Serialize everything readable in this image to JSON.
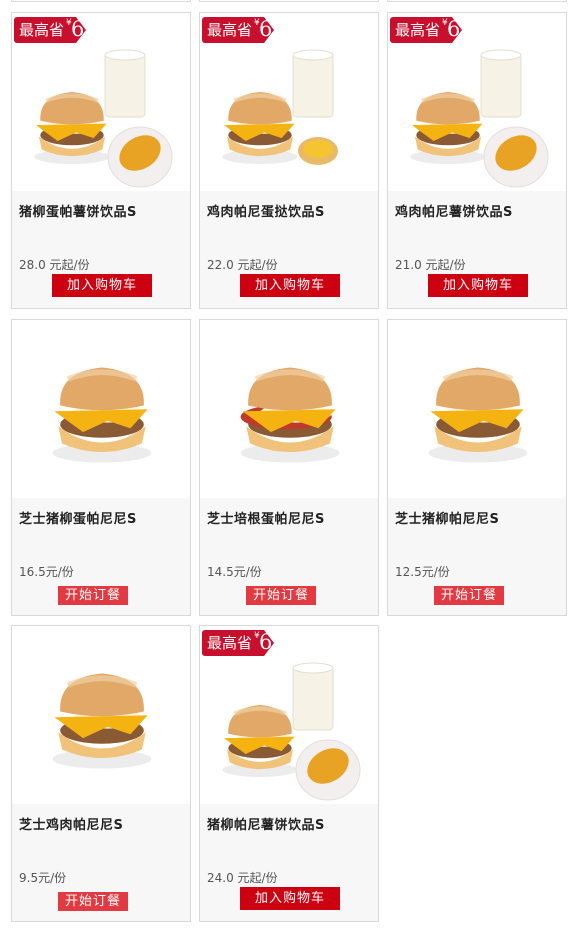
{
  "products": [
    {
      "name": "猪柳蛋帕薯饼饮品S",
      "price": "28.0 元起/份",
      "button": "加入购物车",
      "badge": {
        "label": "最高省",
        "currency": "¥",
        "amount": "6"
      }
    },
    {
      "name": "鸡肉帕尼蛋挞饮品S",
      "price": "22.0 元起/份",
      "button": "加入购物车",
      "badge": {
        "label": "最高省",
        "currency": "¥",
        "amount": "6"
      }
    },
    {
      "name": "鸡肉帕尼薯饼饮品S",
      "price": "21.0 元起/份",
      "button": "加入购物车",
      "badge": {
        "label": "最高省",
        "currency": "¥",
        "amount": "6"
      }
    },
    {
      "name": "芝士猪柳蛋帕尼尼S",
      "price": "16.5元/份",
      "button": "开始订餐"
    },
    {
      "name": "芝士培根蛋帕尼尼S",
      "price": "14.5元/份",
      "button": "开始订餐"
    },
    {
      "name": "芝士猪柳帕尼尼S",
      "price": "12.5元/份",
      "button": "开始订餐"
    },
    {
      "name": "芝士鸡肉帕尼尼S",
      "price": "9.5元/份",
      "button": "开始订餐"
    },
    {
      "name": "猪柳帕尼薯饼饮品S",
      "price": "24.0 元起/份",
      "button": "加入购物车",
      "badge": {
        "label": "最高省",
        "currency": "¥",
        "amount": "6"
      }
    }
  ],
  "images": [
    "sandwich-milk-hashbrown",
    "sandwich-milk-egg-tart",
    "sandwich-milk-hashbrown",
    "sandwich",
    "sandwich-bacon",
    "sandwich",
    "sandwich",
    "sandwich-milk-hashbrown"
  ],
  "colors": {
    "badge": "#c8102e",
    "cart_button": "#cc0011",
    "order_button": "#e23a42",
    "cheese": "#f5b312",
    "bun": "#e2a868"
  }
}
